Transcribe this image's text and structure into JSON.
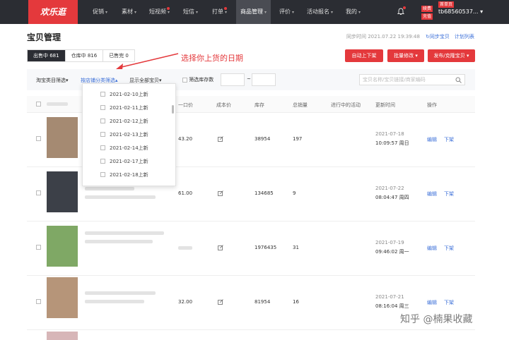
{
  "logo": "欢乐逛",
  "nav": [
    {
      "label": "促销",
      "caret": true,
      "dot": false
    },
    {
      "label": "素材",
      "caret": true,
      "dot": false
    },
    {
      "label": "短视频",
      "caret": true,
      "dot": true
    },
    {
      "label": "短信",
      "caret": true,
      "dot": false
    },
    {
      "label": "打单",
      "caret": true,
      "dot": true
    },
    {
      "label": "商品管理",
      "caret": true,
      "dot": false,
      "active": true
    },
    {
      "label": "评价",
      "caret": true,
      "dot": false
    },
    {
      "label": "活动报名",
      "caret": true,
      "dot": false
    },
    {
      "label": "我的",
      "caret": true,
      "dot": false
    }
  ],
  "user": {
    "tag1": "续费",
    "tag2": "充值",
    "tag3": "首单页",
    "name": "tb68560537..."
  },
  "page": {
    "title": "宝贝管理",
    "sync_label": "同步时间 2021.07.22 19:39:48",
    "sync_link": "同步宝贝",
    "plan_link": "计划列表"
  },
  "status_tabs": [
    "出售中 681",
    "仓库中 816",
    "已售完 0"
  ],
  "annotation": "选择你上货的日期",
  "actions": {
    "toggle": "自动上下架",
    "batch": "批量修改",
    "publish": "发布/克隆宝贝"
  },
  "filters": {
    "category": "淘宝类目筛选",
    "shop_category": "按店铺分类筛选",
    "show_all": "显示全部宝贝",
    "stock_filter": "筛选库存数",
    "range_sep": "~",
    "search_placeholder": "宝贝名称/宝贝链接/商家编码"
  },
  "table": {
    "headers": [
      "一口价",
      "成本价",
      "库存",
      "总销量",
      "进行中的活动",
      "更新时间",
      "操作"
    ],
    "rows": [
      {
        "price": "43.20",
        "stock": "38954",
        "sales": "197",
        "date": "2021-07-18",
        "time": "10:09:57 周日",
        "edit": "编辑",
        "off": "下架"
      },
      {
        "price": "61.00",
        "stock": "134685",
        "sales": "9",
        "date": "2021-07-22",
        "time": "08:04:47 周四",
        "edit": "编辑",
        "off": "下架"
      },
      {
        "price": "",
        "stock": "1976435",
        "sales": "31",
        "date": "2021-07-19",
        "time": "09:46:02 周一",
        "edit": "编辑",
        "off": "下架"
      },
      {
        "price": "32.00",
        "stock": "81954",
        "sales": "16",
        "date": "2021-07-21",
        "time": "08:16:04 周三",
        "edit": "编辑",
        "off": "下架"
      }
    ]
  },
  "dropdown": [
    "2021-02-10上新",
    "2021-02-11上新",
    "2021-02-12上新",
    "2021-02-13上新",
    "2021-02-14上新",
    "2021-02-17上新",
    "2021-02-18上新"
  ],
  "watermark": "知乎 @楠果收藏",
  "colors": {
    "accent": "#e4393c",
    "link": "#3b6fd8",
    "dark": "#2b2d33"
  }
}
